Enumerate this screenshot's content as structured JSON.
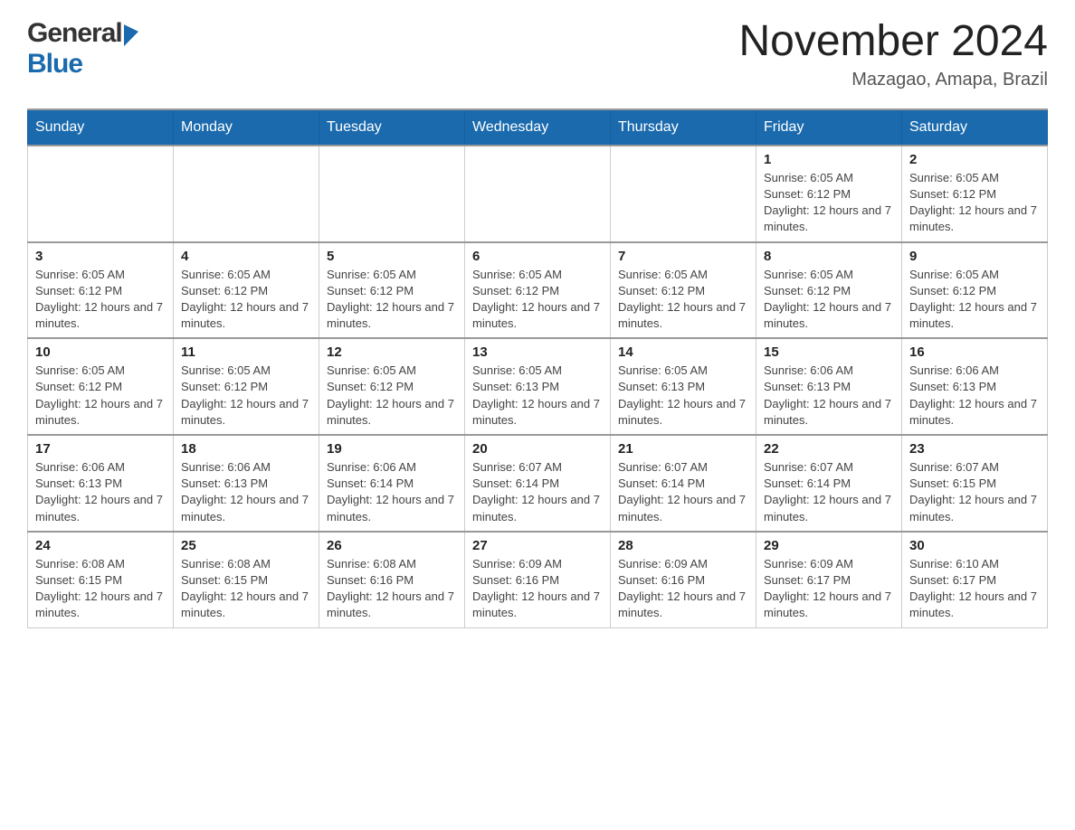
{
  "header": {
    "logo": {
      "general": "General",
      "blue": "Blue"
    },
    "title": "November 2024",
    "location": "Mazagao, Amapa, Brazil"
  },
  "weekdays": [
    "Sunday",
    "Monday",
    "Tuesday",
    "Wednesday",
    "Thursday",
    "Friday",
    "Saturday"
  ],
  "weeks": [
    [
      {
        "day": "",
        "info": ""
      },
      {
        "day": "",
        "info": ""
      },
      {
        "day": "",
        "info": ""
      },
      {
        "day": "",
        "info": ""
      },
      {
        "day": "",
        "info": ""
      },
      {
        "day": "1",
        "info": "Sunrise: 6:05 AM\nSunset: 6:12 PM\nDaylight: 12 hours and 7 minutes."
      },
      {
        "day": "2",
        "info": "Sunrise: 6:05 AM\nSunset: 6:12 PM\nDaylight: 12 hours and 7 minutes."
      }
    ],
    [
      {
        "day": "3",
        "info": "Sunrise: 6:05 AM\nSunset: 6:12 PM\nDaylight: 12 hours and 7 minutes."
      },
      {
        "day": "4",
        "info": "Sunrise: 6:05 AM\nSunset: 6:12 PM\nDaylight: 12 hours and 7 minutes."
      },
      {
        "day": "5",
        "info": "Sunrise: 6:05 AM\nSunset: 6:12 PM\nDaylight: 12 hours and 7 minutes."
      },
      {
        "day": "6",
        "info": "Sunrise: 6:05 AM\nSunset: 6:12 PM\nDaylight: 12 hours and 7 minutes."
      },
      {
        "day": "7",
        "info": "Sunrise: 6:05 AM\nSunset: 6:12 PM\nDaylight: 12 hours and 7 minutes."
      },
      {
        "day": "8",
        "info": "Sunrise: 6:05 AM\nSunset: 6:12 PM\nDaylight: 12 hours and 7 minutes."
      },
      {
        "day": "9",
        "info": "Sunrise: 6:05 AM\nSunset: 6:12 PM\nDaylight: 12 hours and 7 minutes."
      }
    ],
    [
      {
        "day": "10",
        "info": "Sunrise: 6:05 AM\nSunset: 6:12 PM\nDaylight: 12 hours and 7 minutes."
      },
      {
        "day": "11",
        "info": "Sunrise: 6:05 AM\nSunset: 6:12 PM\nDaylight: 12 hours and 7 minutes."
      },
      {
        "day": "12",
        "info": "Sunrise: 6:05 AM\nSunset: 6:12 PM\nDaylight: 12 hours and 7 minutes."
      },
      {
        "day": "13",
        "info": "Sunrise: 6:05 AM\nSunset: 6:13 PM\nDaylight: 12 hours and 7 minutes."
      },
      {
        "day": "14",
        "info": "Sunrise: 6:05 AM\nSunset: 6:13 PM\nDaylight: 12 hours and 7 minutes."
      },
      {
        "day": "15",
        "info": "Sunrise: 6:06 AM\nSunset: 6:13 PM\nDaylight: 12 hours and 7 minutes."
      },
      {
        "day": "16",
        "info": "Sunrise: 6:06 AM\nSunset: 6:13 PM\nDaylight: 12 hours and 7 minutes."
      }
    ],
    [
      {
        "day": "17",
        "info": "Sunrise: 6:06 AM\nSunset: 6:13 PM\nDaylight: 12 hours and 7 minutes."
      },
      {
        "day": "18",
        "info": "Sunrise: 6:06 AM\nSunset: 6:13 PM\nDaylight: 12 hours and 7 minutes."
      },
      {
        "day": "19",
        "info": "Sunrise: 6:06 AM\nSunset: 6:14 PM\nDaylight: 12 hours and 7 minutes."
      },
      {
        "day": "20",
        "info": "Sunrise: 6:07 AM\nSunset: 6:14 PM\nDaylight: 12 hours and 7 minutes."
      },
      {
        "day": "21",
        "info": "Sunrise: 6:07 AM\nSunset: 6:14 PM\nDaylight: 12 hours and 7 minutes."
      },
      {
        "day": "22",
        "info": "Sunrise: 6:07 AM\nSunset: 6:14 PM\nDaylight: 12 hours and 7 minutes."
      },
      {
        "day": "23",
        "info": "Sunrise: 6:07 AM\nSunset: 6:15 PM\nDaylight: 12 hours and 7 minutes."
      }
    ],
    [
      {
        "day": "24",
        "info": "Sunrise: 6:08 AM\nSunset: 6:15 PM\nDaylight: 12 hours and 7 minutes."
      },
      {
        "day": "25",
        "info": "Sunrise: 6:08 AM\nSunset: 6:15 PM\nDaylight: 12 hours and 7 minutes."
      },
      {
        "day": "26",
        "info": "Sunrise: 6:08 AM\nSunset: 6:16 PM\nDaylight: 12 hours and 7 minutes."
      },
      {
        "day": "27",
        "info": "Sunrise: 6:09 AM\nSunset: 6:16 PM\nDaylight: 12 hours and 7 minutes."
      },
      {
        "day": "28",
        "info": "Sunrise: 6:09 AM\nSunset: 6:16 PM\nDaylight: 12 hours and 7 minutes."
      },
      {
        "day": "29",
        "info": "Sunrise: 6:09 AM\nSunset: 6:17 PM\nDaylight: 12 hours and 7 minutes."
      },
      {
        "day": "30",
        "info": "Sunrise: 6:10 AM\nSunset: 6:17 PM\nDaylight: 12 hours and 7 minutes."
      }
    ]
  ]
}
